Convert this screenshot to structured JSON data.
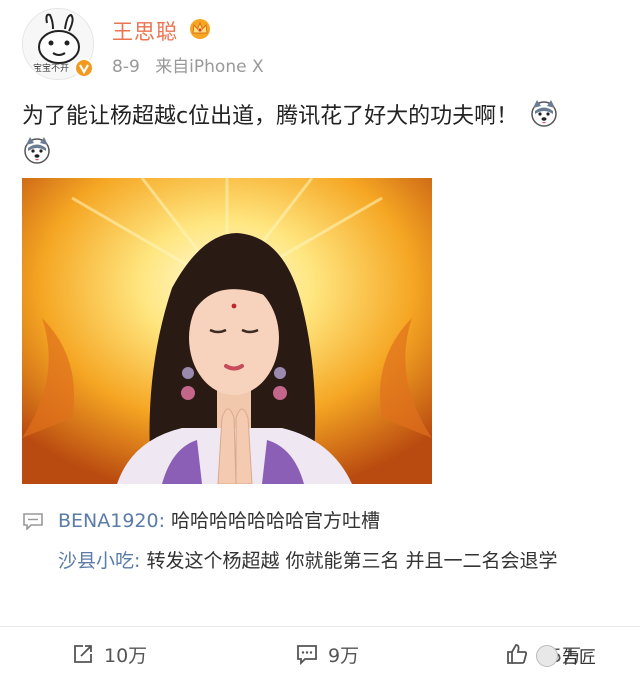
{
  "post": {
    "author": "王思聪",
    "avatar_caption": "宝宝不开",
    "date": "8-9",
    "source": "来自iPhone X",
    "text": "为了能让杨超越c位出道，腾讯花了好大的功夫啊！",
    "verified_icon": "v-badge-icon",
    "member_icon": "crown-icon"
  },
  "comments": [
    {
      "name": "BENA1920:",
      "text": " 哈哈哈哈哈哈哈官方吐槽"
    },
    {
      "name": "沙县小吃:",
      "text": " 转发这个杨超越 你就能第三名 并且一二名会退学"
    }
  ],
  "footer": {
    "repost_count": "10万",
    "comment_count": "9万",
    "like_count": "15万",
    "watermark": "告匠"
  },
  "colors": {
    "username": "#eb7350",
    "comment_name": "#5b7ba8",
    "meta": "#999999"
  }
}
